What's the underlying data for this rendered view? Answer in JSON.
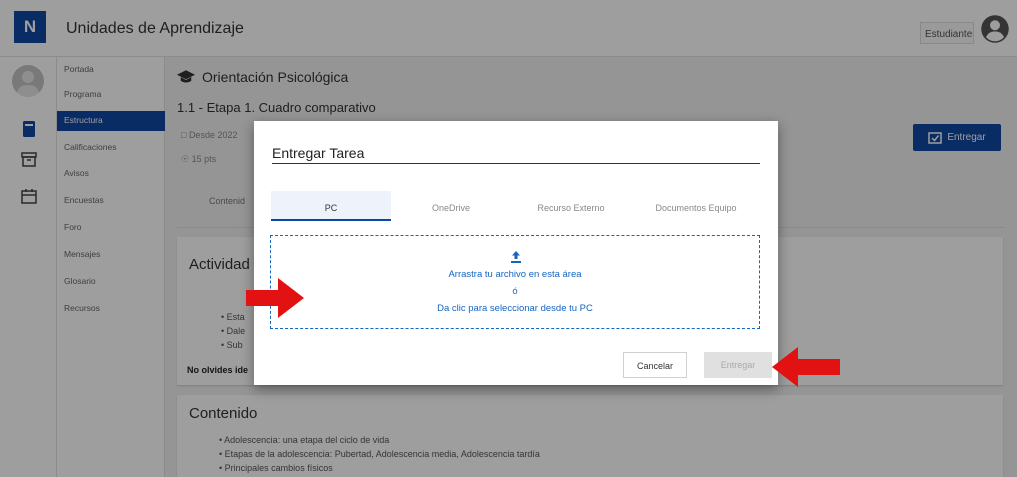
{
  "header": {
    "logo": "N",
    "title": "Unidades de Aprendizaje",
    "user_role": "Estudiante"
  },
  "nav": {
    "items": [
      {
        "label": "Portada"
      },
      {
        "label": "Programa"
      },
      {
        "label": "Estructura"
      },
      {
        "label": "Calificaciones"
      },
      {
        "label": "Avisos"
      },
      {
        "label": "Encuestas"
      },
      {
        "label": "Foro"
      },
      {
        "label": "Mensajes"
      },
      {
        "label": "Glosario"
      },
      {
        "label": "Recursos"
      }
    ],
    "active": "Estructura"
  },
  "main": {
    "course_title": "Orientación Psicológica",
    "task_title": "1.1 - Etapa 1. Cuadro comparativo",
    "date_text": "Desde 2022",
    "points_text": "15 pts",
    "tab_label": "Contenid",
    "submit_button": "Entregar",
    "activity_card": {
      "title": "Actividad",
      "bullets": [
        "Esta",
        "Dale",
        "Sub"
      ],
      "note": "No olvides ide"
    },
    "content_card": {
      "title": "Contenido",
      "bullets": [
        "Adolescencia: una etapa del ciclo de vida",
        "Etapas de la adolescencia: Pubertad, Adolescencia media, Adolescencia tardía",
        "Principales cambios físicos"
      ]
    }
  },
  "modal": {
    "title": "Entregar Tarea",
    "tabs": [
      {
        "label": "PC"
      },
      {
        "label": "OneDrive"
      },
      {
        "label": "Recurso Externo"
      },
      {
        "label": "Documentos Equipo"
      }
    ],
    "active_tab": "PC",
    "dropzone": {
      "line1": "Arrastra tu archivo en esta área",
      "line2": "ó",
      "line3": "Da clic para seleccionar desde tu PC"
    },
    "cancel_label": "Cancelar",
    "submit_label": "Entregar",
    "submit_enabled": false
  },
  "colors": {
    "primary": "#0d47a1",
    "link": "#1565c0",
    "annotation_arrow": "#e31212"
  }
}
